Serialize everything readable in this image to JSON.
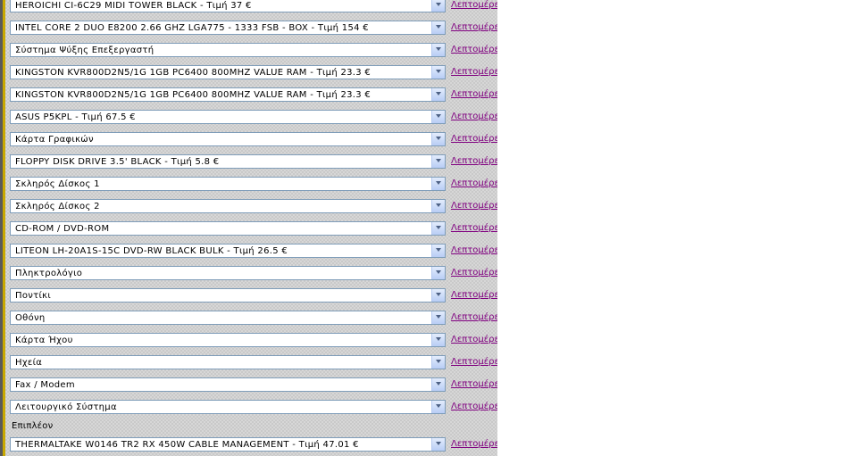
{
  "details_link_label": "Λεπτομέρειες",
  "components": [
    {
      "selected": "HEROICHI CI-6C29 MIDI TOWER BLACK - Τιμή 37 €"
    },
    {
      "selected": "INTEL CORE 2 DUO E8200 2.66 GHZ LGA775 - 1333 FSB - BOX - Τιμή 154 €"
    },
    {
      "selected": "Σύστημα Ψύξης Επεξεργαστή"
    },
    {
      "selected": "KINGSTON KVR800D2N5/1G 1GB PC6400 800MHZ VALUE RAM - Τιμή 23.3 €"
    },
    {
      "selected": "KINGSTON KVR800D2N5/1G 1GB PC6400 800MHZ VALUE RAM - Τιμή 23.3 €"
    },
    {
      "selected": "ASUS P5KPL - Τιμή 67.5 €"
    },
    {
      "selected": "Κάρτα Γραφικών"
    },
    {
      "selected": "FLOPPY DISK DRIVE 3.5' BLACK - Τιμή 5.8 €"
    },
    {
      "selected": "Σκληρός Δίσκος 1"
    },
    {
      "selected": "Σκληρός Δίσκος 2"
    },
    {
      "selected": "CD-ROM / DVD-ROM"
    },
    {
      "selected": "LITEON LH-20A1S-15C DVD-RW BLACK BULK - Τιμή 26.5 €"
    },
    {
      "selected": "Πληκτρολόγιο"
    },
    {
      "selected": "Ποντίκι"
    },
    {
      "selected": "Οθόνη"
    },
    {
      "selected": "Κάρτα Ήχου"
    },
    {
      "selected": "Ηχεία"
    },
    {
      "selected": "Fax / Modem"
    },
    {
      "selected": "Λειτουργικό Σύστημα"
    }
  ],
  "extras_heading": "Επιπλέον",
  "extras": [
    {
      "selected": "THERMALTAKE W0146 TR2 RX 450W CABLE MANAGEMENT - Τιμή 47.01 €"
    }
  ],
  "colors": {
    "link_visited": "#800080",
    "select_border": "#7f9db9",
    "panel_bg": "#d7d7d7"
  }
}
